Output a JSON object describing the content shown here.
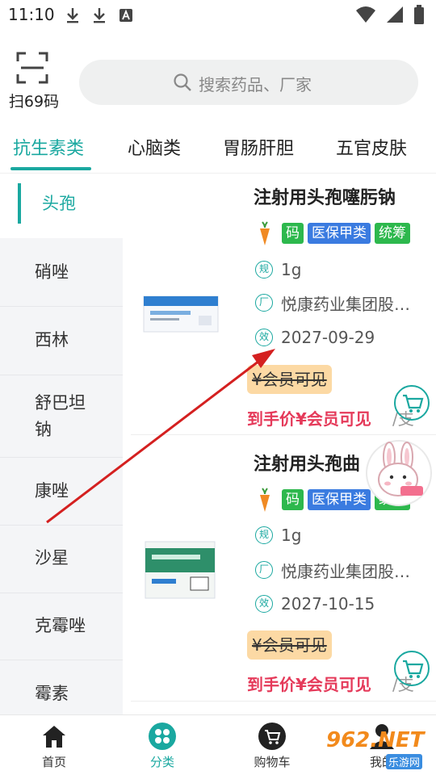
{
  "status_bar": {
    "time": "11:10",
    "left_icons": [
      "download-icon",
      "download-icon",
      "text-notify-icon"
    ],
    "right_icons": [
      "wifi-icon",
      "signal-icon",
      "battery-icon"
    ]
  },
  "header": {
    "scan_label": "扫69码",
    "search_placeholder": "搜索药品、厂家"
  },
  "tabs": [
    {
      "label": "抗生素类",
      "active": true
    },
    {
      "label": "心脑类",
      "active": false
    },
    {
      "label": "胃肠肝胆",
      "active": false
    },
    {
      "label": "五官皮肤",
      "active": false
    }
  ],
  "sidebar": {
    "items": [
      {
        "label": "头孢",
        "active": true
      },
      {
        "label": "硝唑"
      },
      {
        "label": "西林"
      },
      {
        "label": "舒巴坦钠"
      },
      {
        "label": "康唑"
      },
      {
        "label": "沙星"
      },
      {
        "label": "克霉唑"
      },
      {
        "label": "霉素"
      }
    ]
  },
  "products": [
    {
      "name": "注射用头孢噻肟钠",
      "tags": [
        {
          "text": "码",
          "color": "#2db84d"
        },
        {
          "text": "医保甲类",
          "color": "#3a7be0"
        },
        {
          "text": "统筹",
          "color": "#2db84d"
        }
      ],
      "spec_icon": "规",
      "spec": "1g",
      "maker_icon": "厂",
      "maker": "悦康药业集团股…",
      "expiry_icon": "效",
      "expiry": "2027-09-29",
      "member_price": "¥会员可见",
      "final_price": "到手价¥会员可见",
      "unit": "/支"
    },
    {
      "name": "注射用头孢曲",
      "tags": [
        {
          "text": "码",
          "color": "#2db84d"
        },
        {
          "text": "医保甲类",
          "color": "#3a7be0"
        },
        {
          "text": "统筹",
          "color": "#2db84d"
        }
      ],
      "spec_icon": "规",
      "spec": "1g",
      "maker_icon": "厂",
      "maker": "悦康药业集团股…",
      "expiry_icon": "效",
      "expiry": "2027-10-15",
      "member_price": "¥会员可见",
      "final_price": "到手价¥会员可见",
      "unit": "/支"
    }
  ],
  "bottom_nav": [
    {
      "label": "首页",
      "icon": "home-icon",
      "active": false
    },
    {
      "label": "分类",
      "icon": "category-icon",
      "active": true
    },
    {
      "label": "购物车",
      "icon": "cart-icon",
      "active": false
    },
    {
      "label": "我的",
      "icon": "user-icon",
      "active": false
    }
  ],
  "watermark": {
    "text": "962.NET",
    "sub": "乐游网"
  },
  "colors": {
    "accent": "#1aa8a0",
    "price": "#e53a5a",
    "pill": "#fcd9a4",
    "sidebar_bg": "#f4f5f7"
  }
}
